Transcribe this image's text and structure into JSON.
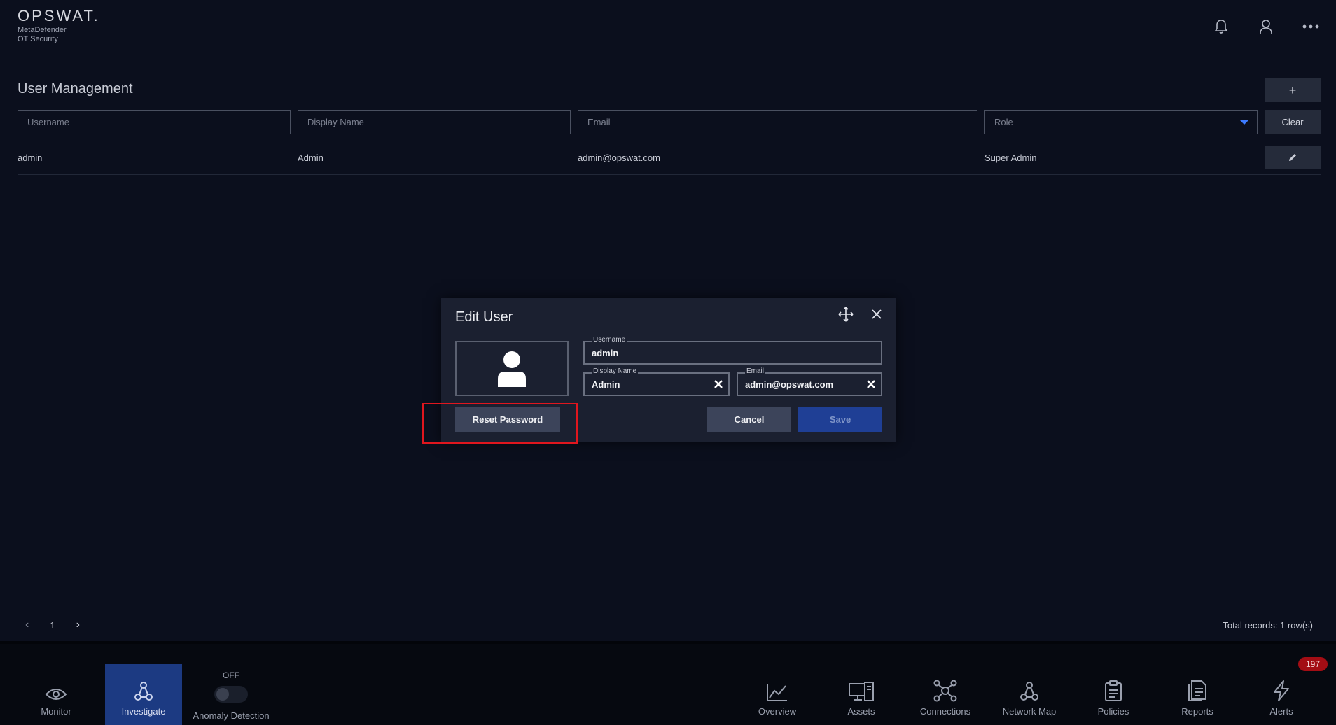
{
  "header": {
    "brand": "OPSWAT.",
    "product_line1": "MetaDefender",
    "product_line2": "OT Security",
    "icons": [
      "bell-icon",
      "user-icon",
      "more-icon"
    ]
  },
  "page": {
    "title": "User Management",
    "add_label": "+"
  },
  "filters": {
    "username_placeholder": "Username",
    "display_name_placeholder": "Display Name",
    "email_placeholder": "Email",
    "role_placeholder": "Role",
    "clear_label": "Clear"
  },
  "users": [
    {
      "username": "admin",
      "display_name": "Admin",
      "email": "admin@opswat.com",
      "role": "Super Admin"
    }
  ],
  "pagination": {
    "prev": "‹",
    "page": "1",
    "next": "›",
    "total": "Total records: 1 row(s)"
  },
  "modal": {
    "title": "Edit User",
    "username_label": "Username",
    "username_value": "admin",
    "display_name_label": "Display Name",
    "display_name_value": "Admin",
    "email_label": "Email",
    "email_value": "admin@opswat.com",
    "reset_label": "Reset Password",
    "cancel_label": "Cancel",
    "save_label": "Save"
  },
  "bottom_nav": {
    "monitor": "Monitor",
    "investigate": "Investigate",
    "anomaly_state": "OFF",
    "anomaly_label": "Anomaly Detection",
    "overview": "Overview",
    "assets": "Assets",
    "connections": "Connections",
    "network_map": "Network Map",
    "policies": "Policies",
    "reports": "Reports",
    "alerts": "Alerts",
    "alerts_count": "197"
  },
  "colors": {
    "background": "#0b0f1d",
    "accent": "#1f3f95",
    "active_nav": "#1c3a82",
    "highlight": "#e0161e",
    "badge": "#a30d14"
  }
}
